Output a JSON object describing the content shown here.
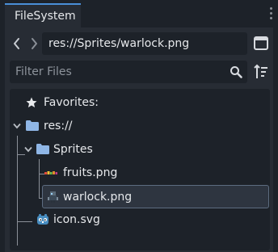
{
  "tab": {
    "title": "FileSystem"
  },
  "nav": {
    "path": "res://Sprites/warlock.png"
  },
  "filter": {
    "placeholder": "Filter Files"
  },
  "tree": {
    "favorites": "Favorites:",
    "root": "res://",
    "folder": "Sprites",
    "files": [
      "fruits.png",
      "warlock.png"
    ],
    "root_file": "icon.svg",
    "selected": "warlock.png"
  },
  "colors": {
    "accent": "#4a8fd8",
    "folder": "#8fb6e6",
    "selection": "#2e3540"
  }
}
